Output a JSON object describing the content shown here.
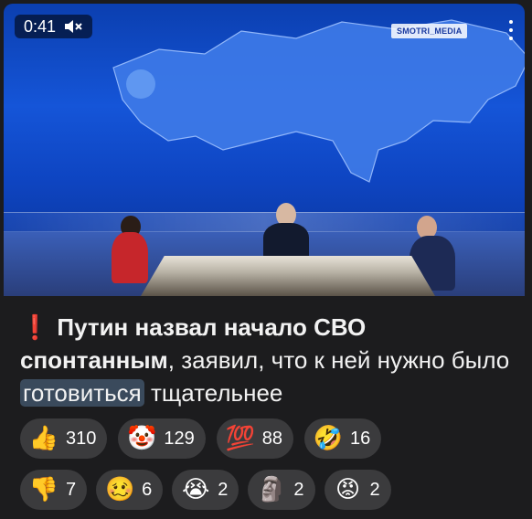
{
  "video": {
    "time": "0:41",
    "mute_icon": "muted-speaker-icon",
    "watermark": "SMOTRI_MEDIA",
    "menu_icon": "more-vertical-icon",
    "colors": {
      "background": "#1555d8"
    }
  },
  "post": {
    "prefix_icon": "red-exclamation-icon",
    "text_bold": "Путин назвал начало СВО спонтанным",
    "text_mid": ", заявил, что к ней нужно было ",
    "text_highlight": "готовиться",
    "text_end": " тщательнее"
  },
  "reactions": [
    {
      "icon": "thumbs-up-icon",
      "emoji": "👍",
      "count": "310"
    },
    {
      "icon": "clown-face-icon",
      "emoji": "🤡",
      "count": "129"
    },
    {
      "icon": "hundred-points-icon",
      "emoji": "💯",
      "count": "88"
    },
    {
      "icon": "rolling-laughing-icon",
      "emoji": "🤣",
      "count": "16"
    },
    {
      "icon": "thumbs-down-icon",
      "emoji": "👎",
      "count": "7"
    },
    {
      "icon": "woozy-face-icon",
      "emoji": "🥴",
      "count": "6"
    },
    {
      "icon": "crying-face-icon",
      "emoji": "😭",
      "count": "2"
    },
    {
      "icon": "moai-icon",
      "emoji": "🗿",
      "count": "2"
    },
    {
      "icon": "angry-face-icon",
      "emoji": "😡",
      "count": "2"
    }
  ]
}
